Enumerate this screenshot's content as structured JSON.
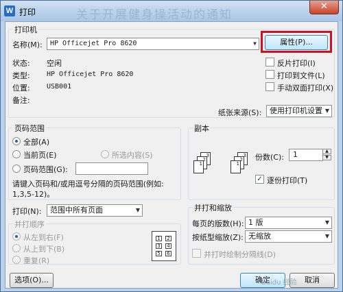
{
  "window": {
    "title": "打印",
    "app_icon_letter": "W",
    "background_text": "关于开展健身操活动的通知"
  },
  "printer": {
    "group_title": "打印机",
    "name_label": "名称(M):",
    "name_value": "HP Officejet Pro 8620",
    "properties_button": "属性(P)...",
    "status_label": "状态:",
    "status_value": "空闲",
    "type_label": "类型:",
    "type_value": "HP Officejet Pro 8620",
    "location_label": "位置:",
    "location_value": "USB001",
    "comment_label": "备注:",
    "reverse_print": "反片打印(I)",
    "print_to_file": "打印到文件(L)",
    "manual_duplex": "手动双面打印(X)",
    "paper_source_label": "纸张来源(S):",
    "paper_source_value": "使用打印机设置"
  },
  "page_range": {
    "group_title": "页码范围",
    "all": "全部(A)",
    "current": "当前页(E)",
    "selection": "所选内容(S)",
    "pages": "页码范围(G):",
    "hint_line1": "请键入页码和/或用逗号分隔的页码范围(例如:",
    "hint_line2": "1,3,5-12)。"
  },
  "copies": {
    "group_title": "副本",
    "count_label": "份数(C):",
    "count_value": "1",
    "collate": "逐份打印(T)"
  },
  "print_what": {
    "label": "打印(N):",
    "value": "范围中所有页面",
    "order_title": "并打顺序",
    "left_to_right": "从左到右(F)",
    "top_to_bottom": "从上到下(B)",
    "repeat": "重复(R)",
    "grid_cells": [
      "1",
      "2",
      "3",
      "4",
      "5",
      "6"
    ]
  },
  "zoom": {
    "group_title": "并打和缩放",
    "pages_per_sheet_label": "每页的版数(H):",
    "pages_per_sheet_value": "1 版",
    "scale_label": "按纸型缩放(Z):",
    "scale_value": "无缩放",
    "draw_borders": "并打时绘制分隔线(D)"
  },
  "footer": {
    "options_button": "选项(O)...",
    "ok_button": "确定",
    "cancel_button": "取消",
    "watermark": "Baidu 经验"
  },
  "colors": {
    "highlight": "#d0101f",
    "title_bar": "#b9d1ea"
  }
}
